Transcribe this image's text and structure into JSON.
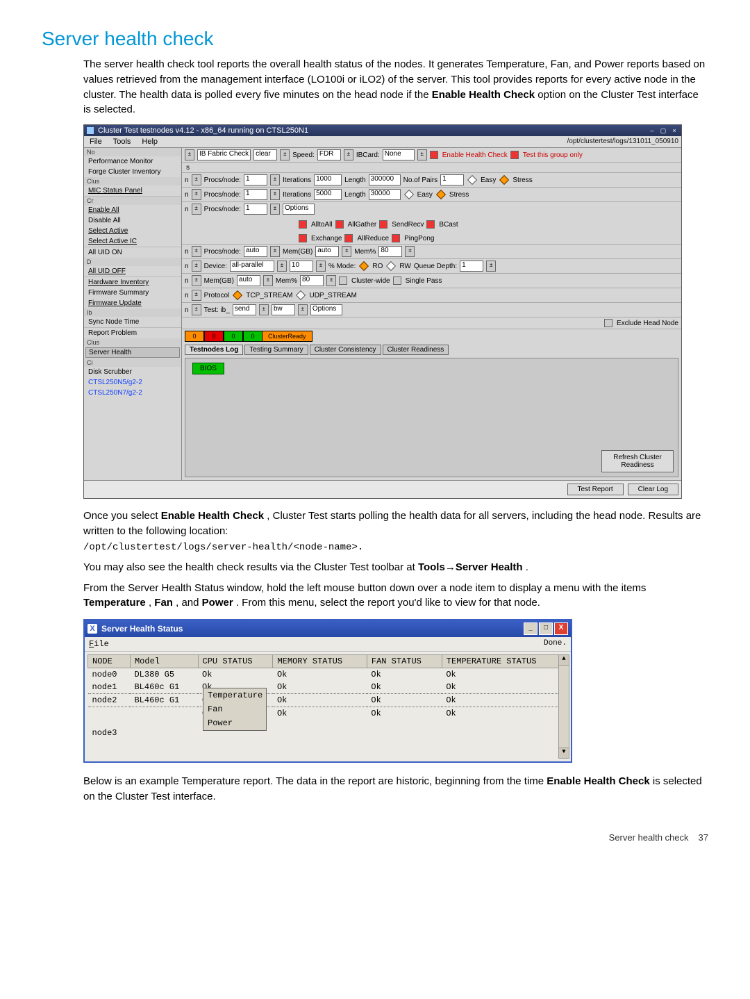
{
  "heading": "Server health check",
  "para1_a": "The server health check tool reports the overall health status of the nodes. It generates Temperature, Fan, and Power reports based on values retrieved from the management interface (LO100i or iLO2) of the server. This tool provides reports for every active node in the cluster. The health data is polled every five minutes on the head node if the ",
  "para1_bold": "Enable Health Check",
  "para1_b": " option on the Cluster Test interface is selected.",
  "win": {
    "title": "Cluster Test testnodes v4.12  -  x86_64 running on CTSL250N1",
    "menus": [
      "File",
      "Tools",
      "Help"
    ],
    "log_path": "/opt/clustertest/logs/131011_050910",
    "sidebar_top_lbl": "No",
    "sidebar_groups": {
      "perf": "Performance Monitor",
      "forge": "Forge Cluster Inventory",
      "mic": "MIC Status Panel",
      "enable_all": "Enable All",
      "disable_all": "Disable All",
      "sel_active": "Select Active",
      "sel_active_ic": "Select Active IC",
      "uid_on": "All UID ON",
      "uid_off": "All UID OFF",
      "hw_inv": "Hardware Inventory",
      "fw_sum": "Firmware Summary",
      "fw_upd": "Firmware Update",
      "sync": "Sync Node Time",
      "report": "Report Problem",
      "srv_health": "Server Health",
      "disk_scrub": "Disk Scrubber",
      "n1": "CTSL250N5/g2-2",
      "n2": "CTSL250N7/g2-2"
    },
    "side_labels": {
      "clus": "Clus",
      "cr": "Cr",
      "d": "D",
      "ib": "Ib",
      "clus2": "Clus",
      "ci": "Ci"
    },
    "tb": {
      "ib_fabric": "IB Fabric Check",
      "clear": "clear",
      "speed_lbl": "Speed:",
      "speed_val": "FDR",
      "ibcard_lbl": "IBCard:",
      "ibcard_val": "None",
      "enable_hc": "Enable Health Check",
      "test_group": "Test this group only"
    },
    "rows": {
      "r1": {
        "procs": "Procs/node:",
        "pv": "1",
        "iter": "Iterations",
        "iv": "1000",
        "len": "Length",
        "lv": "300000",
        "pairs": "No.of Pairs",
        "pvv": "1",
        "easy": "Easy",
        "stress": "Stress"
      },
      "r2": {
        "procs": "Procs/node:",
        "pv": "1",
        "iter": "Iterations",
        "iv": "5000",
        "len": "Length",
        "lv": "30000",
        "easy": "Easy",
        "stress": "Stress"
      },
      "r3": {
        "procs": "Procs/node:",
        "pv": "1",
        "opts": "Options",
        "a2a": "AlltoAll",
        "ag": "AllGather",
        "sr": "SendRecv",
        "bc": "BCast",
        "ex": "Exchange",
        "ar": "AllReduce",
        "pp": "PingPong"
      },
      "r4": {
        "procs": "Procs/node:",
        "pv": "auto",
        "memgb": "Mem(GB)",
        "mv": "auto",
        "memp": "Mem%",
        "mpv": "80"
      },
      "r5": {
        "dev": "Device:",
        "dv": "all-parallel",
        "ten": "10",
        "pmode": "% Mode:",
        "ro": "RO",
        "rw": "RW",
        "qd": "Queue Depth:",
        "qv": "1"
      },
      "r6": {
        "memgb": "Mem(GB)",
        "mv": "auto",
        "memp": "Mem%",
        "mpv": "80",
        "cw": "Cluster-wide",
        "sp": "Single Pass"
      },
      "r7": {
        "proto": "Protocol",
        "tcp": "TCP_STREAM",
        "udp": "UDP_STREAM"
      },
      "r8": {
        "test": "Test: ib_",
        "tv": "send",
        "bw": "bw",
        "opts": "Options"
      }
    },
    "status_msg": "ClusterReady",
    "exclude_head": "Exclude Head Node",
    "tabs": [
      "Testnodes Log",
      "Testing Summary",
      "Cluster Consistency",
      "Cluster Readiness"
    ],
    "bios": "BIOS",
    "refresh": "Refresh Cluster Readiness",
    "test_report": "Test Report",
    "clear_log": "Clear Log",
    "zeros": [
      "0",
      "0",
      "0",
      "0"
    ]
  },
  "para2_a": "Once you select ",
  "para2_bold": "Enable Health Check",
  "para2_b": ", Cluster Test starts polling the health data for all servers, including the head node. Results are written to the following location:",
  "para2_path": "/opt/clustertest/logs/server-health/<node-name>.",
  "para3_a": "You may also see the health check results via the Cluster Test toolbar at ",
  "para3_bold": "Tools→Server Health",
  "para3_b": ".",
  "para4_a": "From the Server Health Status window, hold the left mouse button down over a node item to display a menu with the items ",
  "para4_t": "Temperature",
  "para4_c1": ", ",
  "para4_f": "Fan",
  "para4_c2": ", and ",
  "para4_p": "Power",
  "para4_b": ". From this menu, select the report you'd like to view for that node.",
  "win2": {
    "title": "Server Health Status",
    "file": "File",
    "done": "Done.",
    "cols": [
      "NODE",
      "Model",
      "CPU STATUS",
      "MEMORY STATUS",
      "FAN STATUS",
      "TEMPERATURE STATUS"
    ],
    "rows": [
      {
        "n": "node0",
        "m": "DL380 G5",
        "c": "Ok",
        "mem": "Ok",
        "f": "Ok",
        "t": "Ok"
      },
      {
        "n": "node1",
        "m": "BL460c G1",
        "c": "Ok",
        "mem": "Ok",
        "f": "Ok",
        "t": "Ok"
      },
      {
        "n": "node2",
        "m": "BL460c G1",
        "c": "Ok",
        "mem": "Ok",
        "f": "Ok",
        "t": "Ok"
      },
      {
        "n": "node3",
        "m": "",
        "c": "Ok",
        "mem": "Ok",
        "f": "Ok",
        "t": "Ok"
      }
    ],
    "ctx": [
      "Temperature",
      "Fan",
      "Power"
    ]
  },
  "para5_a": "Below is an example Temperature report. The data in the report are historic, beginning from the time ",
  "para5_bold": "Enable Health Check",
  "para5_b": " is selected on the Cluster Test interface.",
  "footer_label": "Server health check",
  "footer_page": "37"
}
